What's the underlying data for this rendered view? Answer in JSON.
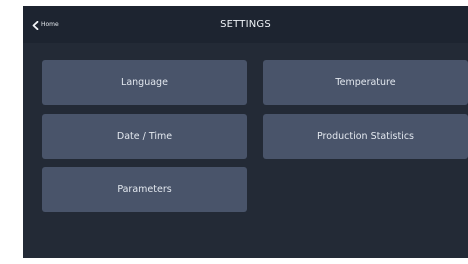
{
  "header": {
    "back_label": "Home",
    "title": "SETTINGS"
  },
  "tiles": [
    {
      "label": "Language"
    },
    {
      "label": "Temperature"
    },
    {
      "label": "Date / Time"
    },
    {
      "label": "Production Statistics"
    },
    {
      "label": "Parameters"
    }
  ],
  "colors": {
    "background": "#232a36",
    "header": "#1d2430",
    "tile": "#49546a",
    "text": "#e3e8ef"
  },
  "icons": {
    "back": "chevron-left-icon"
  }
}
